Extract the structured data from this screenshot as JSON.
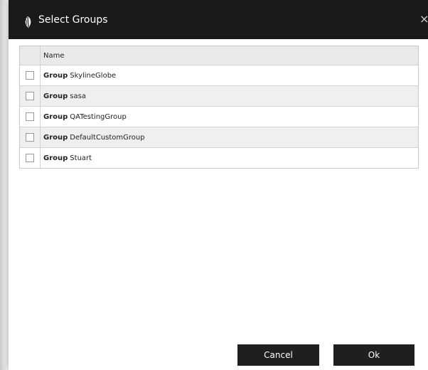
{
  "dialog": {
    "title": "Select Groups",
    "close_label": "×"
  },
  "grid": {
    "header": "Name",
    "rows": [
      {
        "type_label": "Group",
        "name": "SkylineGlobe",
        "checked": false
      },
      {
        "type_label": "Group",
        "name": "sasa",
        "checked": false
      },
      {
        "type_label": "Group",
        "name": "QATestingGroup",
        "checked": false
      },
      {
        "type_label": "Group",
        "name": "DefaultCustomGroup",
        "checked": false
      },
      {
        "type_label": "Group",
        "name": "Stuart",
        "checked": false
      }
    ]
  },
  "buttons": {
    "cancel": "Cancel",
    "ok": "Ok"
  },
  "icons": {
    "logo": "leaf-logo-icon",
    "close": "close-icon"
  },
  "colors": {
    "titlebar": "#1a1a1a",
    "button": "#1f1f1f",
    "header_row": "#e9e9e9",
    "alt_row": "#efefef"
  }
}
